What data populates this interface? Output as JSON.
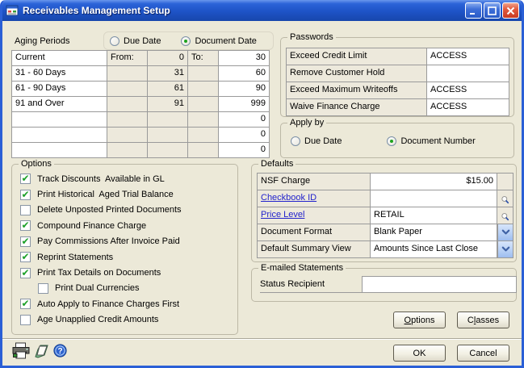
{
  "window": {
    "title": "Receivables Management Setup"
  },
  "colors": {
    "window_background": "#ECE9D8",
    "titlebar_blue": "#1E53C6",
    "close_red": "#E25B3F",
    "check_green": "#1CA028",
    "radio_green": "#1EA31E",
    "link_blue": "#2222CC"
  },
  "icons": {
    "app": "window-form-icon",
    "minimize": "_",
    "maximize": "□",
    "close": "✕",
    "lookup": "magnifier",
    "dropdown": "chevron-down",
    "print": "printer",
    "note": "page",
    "help": "?"
  },
  "aging": {
    "section_label": "Aging Periods",
    "radio_due_date": "Due Date",
    "due_date_selected": false,
    "radio_document_date": "Document Date",
    "document_date_selected": true,
    "from_label": "From:",
    "to_label": "To:",
    "rows": [
      {
        "name": "Current",
        "from": "0",
        "to": "30"
      },
      {
        "name": "31 - 60 Days",
        "from": "31",
        "to": "60"
      },
      {
        "name": "61 - 90 Days",
        "from": "61",
        "to": "90"
      },
      {
        "name": "91 and Over",
        "from": "91",
        "to": "999"
      },
      {
        "name": "",
        "from": "",
        "to": "0"
      },
      {
        "name": "",
        "from": "",
        "to": "0"
      },
      {
        "name": "",
        "from": "",
        "to": "0"
      }
    ]
  },
  "passwords": {
    "section_label": "Passwords",
    "rows": [
      {
        "label": "Exceed Credit Limit",
        "value": "ACCESS"
      },
      {
        "label": "Remove Customer Hold",
        "value": ""
      },
      {
        "label": "Exceed Maximum Writeoffs",
        "value": "ACCESS"
      },
      {
        "label": "Waive Finance Charge",
        "value": "ACCESS"
      }
    ]
  },
  "apply_by": {
    "section_label": "Apply by",
    "radio_due_date": "Due Date",
    "due_date_selected": false,
    "radio_document_number": "Document Number",
    "document_number_selected": true
  },
  "options": {
    "section_label": "Options",
    "items": [
      {
        "label": "Track Discounts  Available in GL",
        "checked": true,
        "indent": false
      },
      {
        "label": "Print Historical  Aged Trial Balance",
        "checked": true,
        "indent": false
      },
      {
        "label": "Delete Unposted Printed Documents",
        "checked": false,
        "indent": false
      },
      {
        "label": "Compound Finance Charge",
        "checked": true,
        "indent": false
      },
      {
        "label": "Pay Commissions After Invoice Paid",
        "checked": true,
        "indent": false
      },
      {
        "label": "Reprint Statements",
        "checked": true,
        "indent": false
      },
      {
        "label": "Print Tax Details on Documents",
        "checked": true,
        "indent": false
      },
      {
        "label": "Print Dual Currencies",
        "checked": false,
        "indent": true
      },
      {
        "label": "Auto Apply to Finance Charges First",
        "checked": true,
        "indent": false
      },
      {
        "label": "Age Unapplied Credit Amounts",
        "checked": false,
        "indent": false
      }
    ]
  },
  "defaults": {
    "section_label": "Defaults",
    "nsf_charge": {
      "label": "NSF Charge",
      "value": "$15.00"
    },
    "checkbook_id": {
      "label": "Checkbook ID",
      "value": ""
    },
    "price_level": {
      "label": "Price Level",
      "value": "RETAIL"
    },
    "document_format": {
      "label": "Document Format",
      "value": "Blank Paper"
    },
    "default_summary_view": {
      "label": "Default Summary View",
      "value": "Amounts Since Last Close"
    }
  },
  "emailed_statements": {
    "section_label": "E-mailed Statements",
    "status_recipient_label": "Status Recipient",
    "status_recipient_value": ""
  },
  "buttons": {
    "options": {
      "pre": "",
      "key": "O",
      "post": "ptions"
    },
    "classes": {
      "pre": "C",
      "key": "l",
      "post": "asses"
    },
    "ok": "OK",
    "cancel": "Cancel"
  }
}
